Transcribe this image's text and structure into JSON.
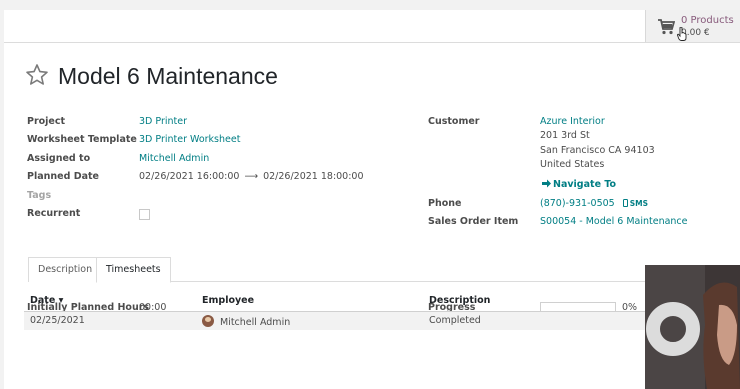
{
  "cart": {
    "count_label": "0 Products",
    "total_label": "0.00 €"
  },
  "task": {
    "title": "Model 6 Maintenance"
  },
  "fields_left": {
    "project_label": "Project",
    "project_value": "3D Printer",
    "worksheet_label": "Worksheet Template",
    "worksheet_value": "3D Printer Worksheet",
    "assigned_label": "Assigned to",
    "assigned_value": "Mitchell Admin",
    "planned_label": "Planned Date",
    "planned_start": "02/26/2021 16:00:00",
    "planned_arrow": "⟶",
    "planned_end": "02/26/2021 18:00:00",
    "tags_label": "Tags",
    "recurrent_label": "Recurrent"
  },
  "fields_right": {
    "customer_label": "Customer",
    "customer_name": "Azure Interior",
    "address_line1": "201 3rd St",
    "address_line2": "San Francisco CA 94103",
    "address_line3": "United States",
    "navigate_label": "Navigate To",
    "phone_label": "Phone",
    "phone_value": "(870)-931-0505",
    "sms_label": "SMS",
    "sale_item_label": "Sales Order Item",
    "sale_item_value": "S00054 - Model 6 Maintenance"
  },
  "tabs": [
    {
      "label": "Description",
      "active": false
    },
    {
      "label": "Timesheets",
      "active": true
    }
  ],
  "timesheets": {
    "planned_hours_label": "Initially Planned Hours",
    "planned_hours_value": "00:00",
    "progress_label": "Progress",
    "progress_percent": 0,
    "progress_text": "0%",
    "columns": [
      "Date",
      "Employee",
      "Description"
    ],
    "sort_indicator": "▾",
    "rows": [
      {
        "date": "02/25/2021",
        "employee": "Mitchell Admin",
        "description": "Completed"
      }
    ]
  },
  "colors": {
    "link": "#017e84",
    "brand": "#875a7b"
  }
}
